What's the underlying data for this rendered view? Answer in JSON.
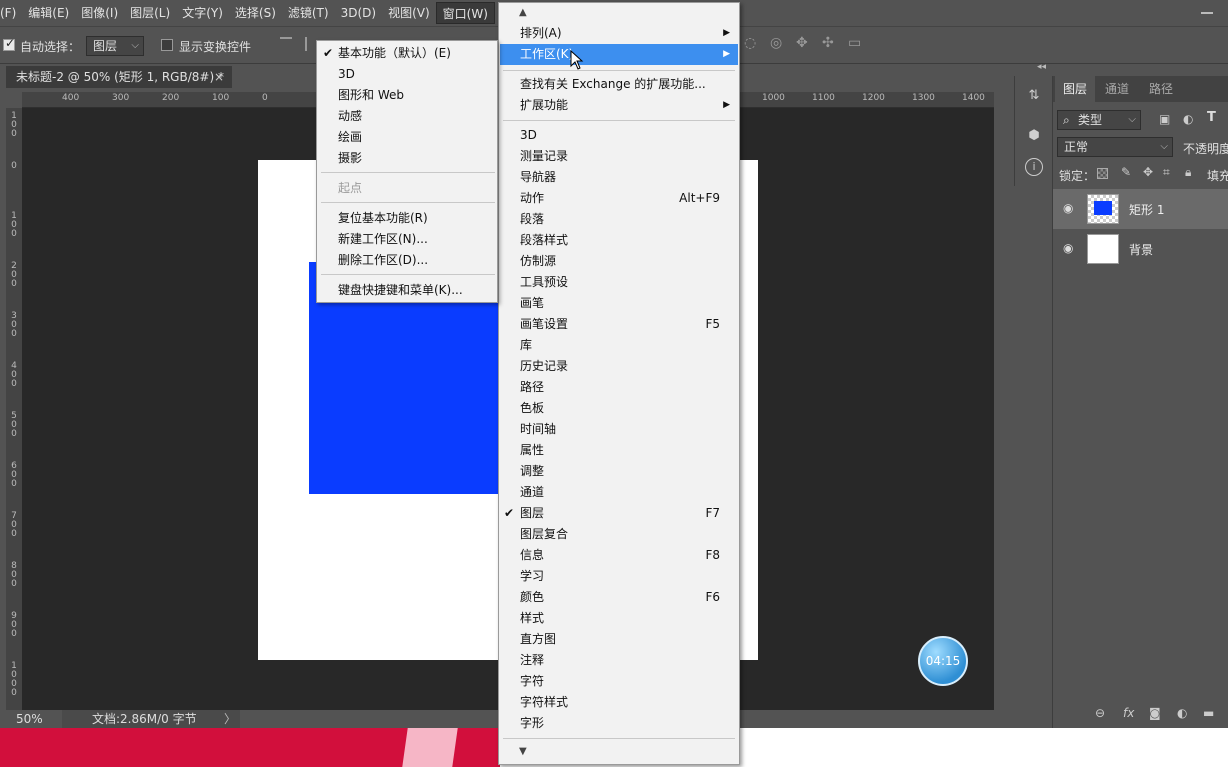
{
  "menubar": {
    "items": [
      "(F)",
      "编辑(E)",
      "图像(I)",
      "图层(L)",
      "文字(Y)",
      "选择(S)",
      "滤镜(T)",
      "3D(D)",
      "视图(V)",
      "窗口(W)"
    ]
  },
  "options_bar": {
    "auto_select_label": "自动选择：",
    "auto_select_value": "图层",
    "show_transform_label": "显示变换控件"
  },
  "document": {
    "tab_title": "未标题-2 @ 50% (矩形 1, RGB/8#) *",
    "tab_close": "×",
    "zoom": "50%",
    "doc_info": "文档:2.86M/0 字节",
    "doc_info_arrow": "〉"
  },
  "rulers": {
    "top": [
      "400",
      "300",
      "200",
      "100",
      "0",
      "1000",
      "1100",
      "1200",
      "1300",
      "1400"
    ],
    "left": [
      "1 0 0",
      "0",
      "1 0 0",
      "2 0 0",
      "3 0 0",
      "4 0 0",
      "5 0 0",
      "6 0 0",
      "7 0 0",
      "8 0 0",
      "9 0 0",
      "1 0 0 0"
    ]
  },
  "timer": "04:15",
  "layers_panel": {
    "tabs": [
      "图层",
      "通道",
      "路径"
    ],
    "filter_label": "类型",
    "blend_mode": "正常",
    "opacity_label": "不透明度",
    "lock_label": "锁定：",
    "fill_label": "填充",
    "layers": [
      {
        "name": "矩形 1",
        "selected": true
      },
      {
        "name": "背景",
        "selected": false
      }
    ],
    "footer_fx": "fx"
  },
  "window_menu": {
    "items": [
      {
        "label": "排列(A)",
        "submenu": true
      },
      {
        "label": "工作区(K)",
        "submenu": true,
        "highlighted": true
      },
      {
        "label": "查找有关 Exchange 的扩展功能..."
      },
      {
        "label": "扩展功能",
        "submenu": true
      },
      {
        "label": "3D"
      },
      {
        "label": "测量记录"
      },
      {
        "label": "导航器"
      },
      {
        "label": "动作",
        "shortcut": "Alt+F9"
      },
      {
        "label": "段落"
      },
      {
        "label": "段落样式"
      },
      {
        "label": "仿制源"
      },
      {
        "label": "工具预设"
      },
      {
        "label": "画笔"
      },
      {
        "label": "画笔设置",
        "shortcut": "F5"
      },
      {
        "label": "库"
      },
      {
        "label": "历史记录"
      },
      {
        "label": "路径"
      },
      {
        "label": "色板"
      },
      {
        "label": "时间轴"
      },
      {
        "label": "属性"
      },
      {
        "label": "调整"
      },
      {
        "label": "通道"
      },
      {
        "label": "图层",
        "shortcut": "F7",
        "checked": true
      },
      {
        "label": "图层复合"
      },
      {
        "label": "信息",
        "shortcut": "F8"
      },
      {
        "label": "学习"
      },
      {
        "label": "颜色",
        "shortcut": "F6"
      },
      {
        "label": "样式"
      },
      {
        "label": "直方图"
      },
      {
        "label": "注释"
      },
      {
        "label": "字符"
      },
      {
        "label": "字符样式"
      },
      {
        "label": "字形"
      }
    ]
  },
  "workspace_menu": {
    "items": [
      {
        "label": "基本功能（默认）(E)",
        "checked": true
      },
      {
        "label": "3D"
      },
      {
        "label": "图形和 Web"
      },
      {
        "label": "动感"
      },
      {
        "label": "绘画"
      },
      {
        "label": "摄影"
      },
      {
        "label": "起点",
        "disabled": true
      },
      {
        "label": "复位基本功能(R)"
      },
      {
        "label": "新建工作区(N)..."
      },
      {
        "label": "删除工作区(D)..."
      },
      {
        "label": "键盘快捷键和菜单(K)..."
      }
    ]
  },
  "colors": {
    "shape_fill": "#0a3cff",
    "menu_highlight": "#3d8fef",
    "ui_bg": "#535353",
    "canvas_bg": "#282828"
  }
}
